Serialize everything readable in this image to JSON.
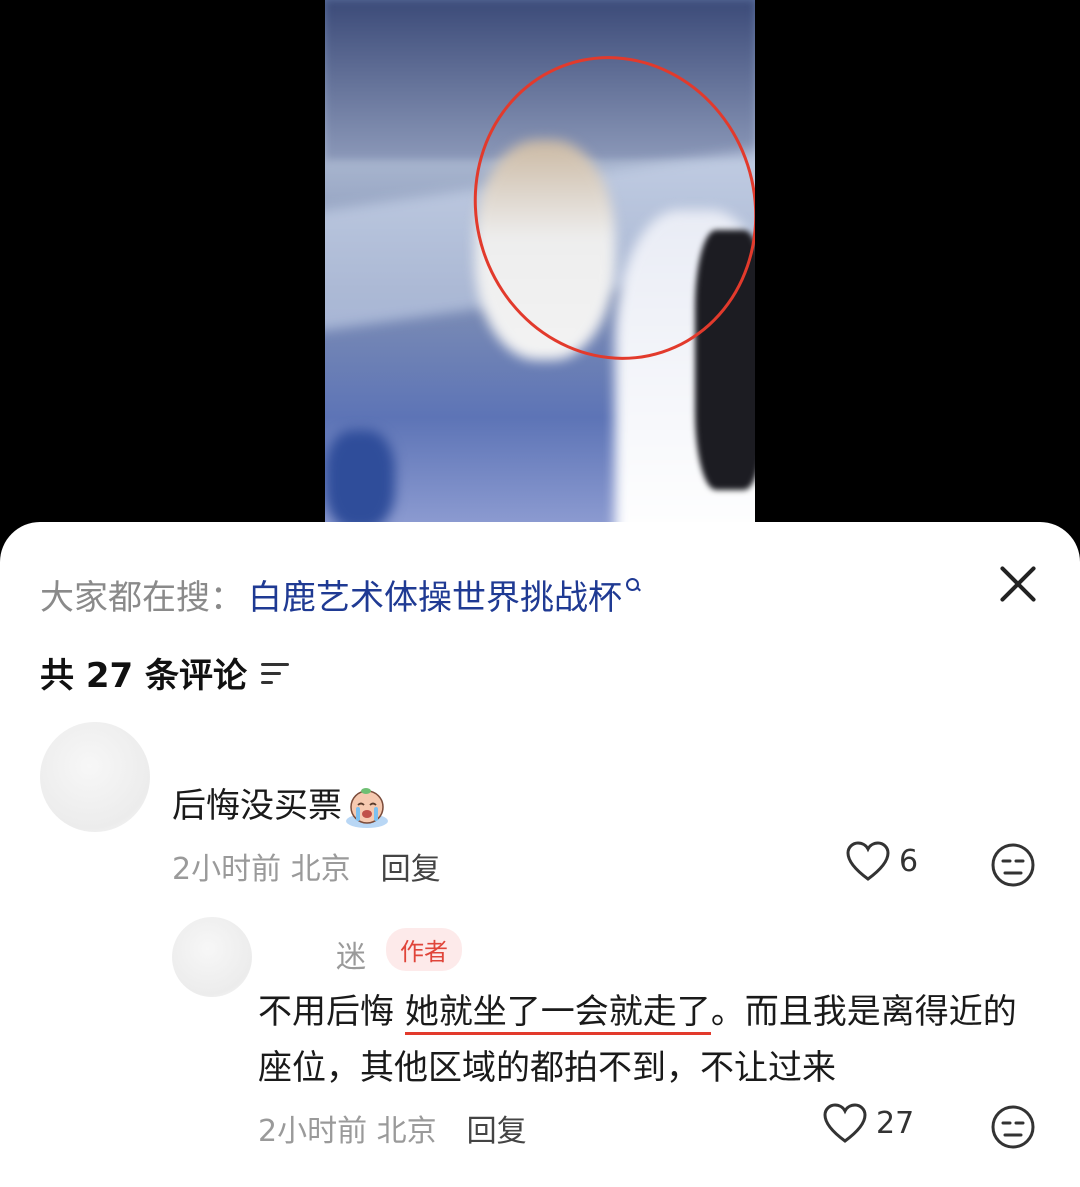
{
  "search": {
    "prefix": "大家都在搜：",
    "term": "白鹿艺术体操世界挑战杯"
  },
  "comments_header": {
    "count_label": "共 27 条评论"
  },
  "comments": [
    {
      "username": "",
      "text": "后悔没买票",
      "emoji": "crying-face-emoji",
      "time": "2小时前 北京",
      "reply_label": "回复",
      "likes": "6"
    },
    {
      "username": "迷",
      "badge": "作者",
      "text_plain": "不用后悔 ",
      "text_underlined": "她就坐了一会就走了",
      "text_rest": "。而且我是离得近的座位，其他区域的都拍不到，不让过来",
      "time": "2小时前 北京",
      "reply_label": "回复",
      "likes": "27"
    }
  ],
  "colors": {
    "accent_link": "#1f3a93",
    "annotation": "#e23a2c",
    "badge_text": "#e0453a",
    "badge_bg": "#fdeaea"
  }
}
